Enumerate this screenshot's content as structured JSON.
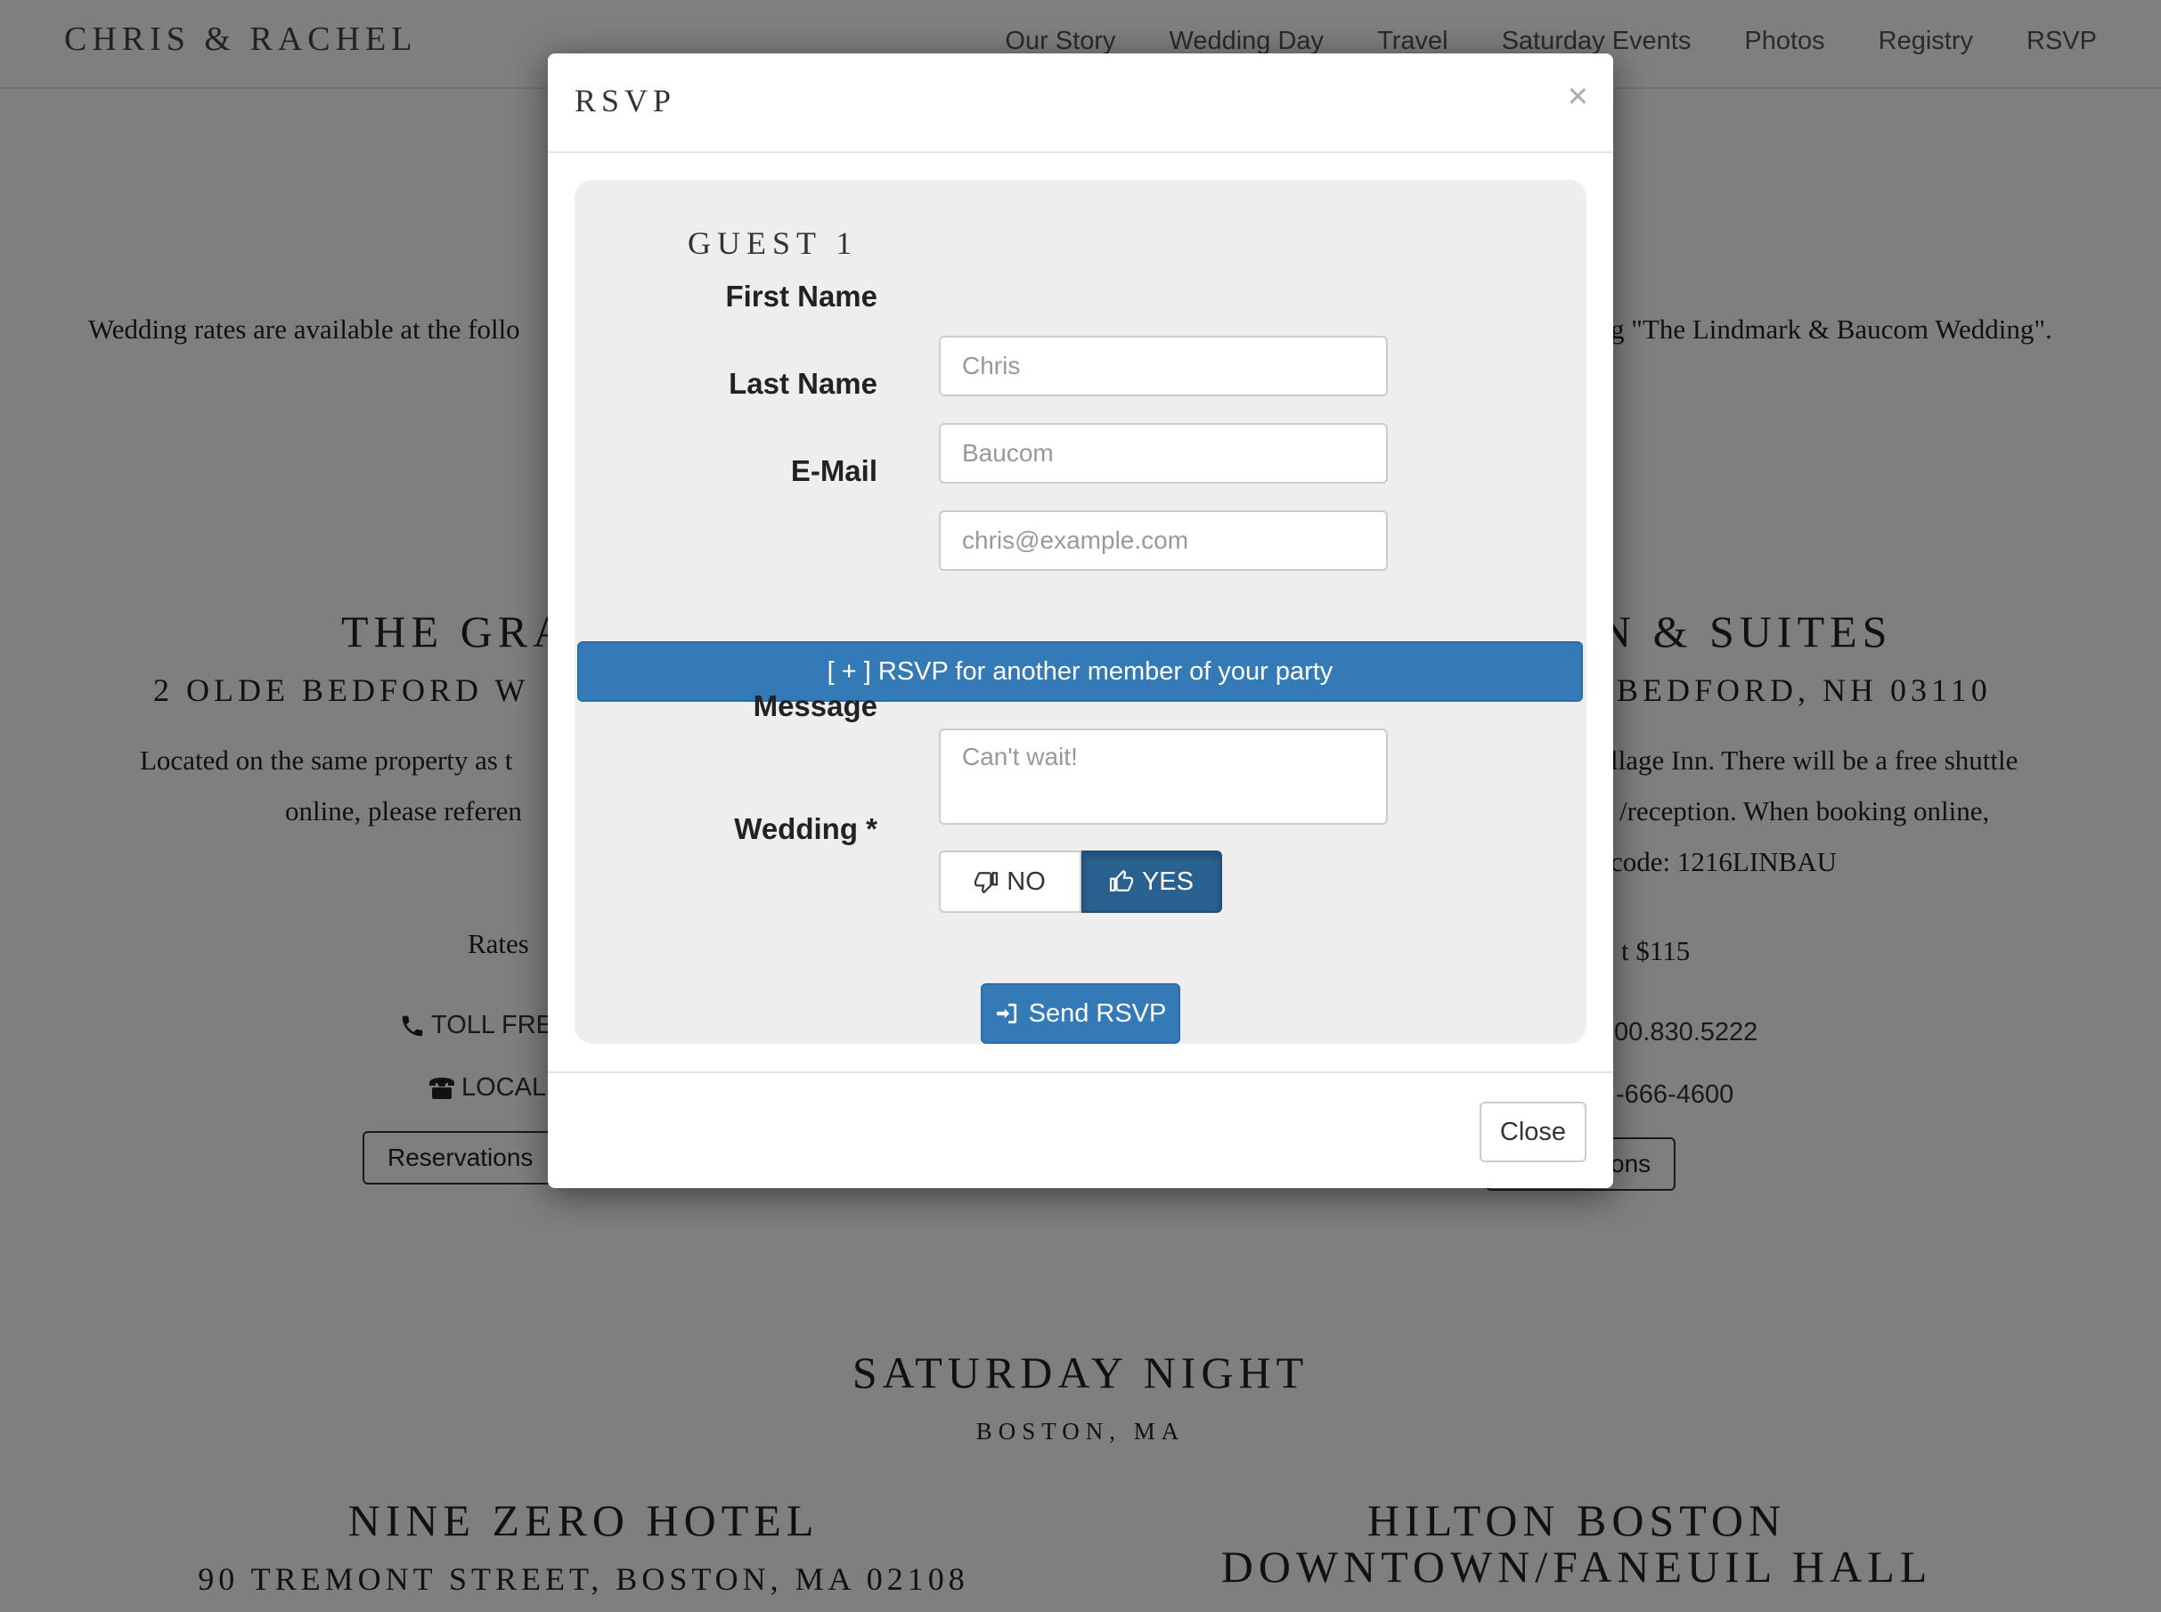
{
  "nav": {
    "brand": "CHRIS & RACHEL",
    "links": [
      "Our Story",
      "Wedding Day",
      "Travel",
      "Saturday Events",
      "Photos",
      "Registry",
      "RSVP"
    ]
  },
  "background": {
    "intro_left": "Wedding rates are available at the follo",
    "intro_right": "g \"The Lindmark & Baucom Wedding\".",
    "hotel_left": {
      "title": "THE GRA",
      "address": "2 OLDE BEDFORD W",
      "para_line1": "Located on the same property as t",
      "para_line2": "online, please referen",
      "rates": "Rates",
      "toll_free": "TOLL FRE",
      "local": "LOCAL",
      "button": "Reservations"
    },
    "hotel_right": {
      "title": "N & SUITES",
      "address": ", BEDFORD, NH 03110",
      "para_line1": "llage Inn. There will be a free shuttle",
      "para_line2": "/reception. When booking online,",
      "para_line3": "code: 1216LINBAU",
      "rates": "t $115",
      "toll_free": "00.830.5222",
      "local": "-666-4600",
      "button": "ons"
    },
    "saturday": {
      "title": "SATURDAY NIGHT",
      "subtitle": "BOSTON, MA"
    },
    "hotel3": {
      "title": "NINE ZERO HOTEL",
      "address": "90 TREMONT STREET, BOSTON, MA 02108"
    },
    "hotel4": {
      "title_line1": "HILTON BOSTON",
      "title_line2": "DOWNTOWN/FANEUIL HALL"
    }
  },
  "modal": {
    "title": "RSVP",
    "close_symbol": "×",
    "guest_heading": "GUEST 1",
    "first_name_label": "First Name",
    "first_name_placeholder": "Chris",
    "last_name_label": "Last Name",
    "last_name_placeholder": "Baucom",
    "email_label": "E-Mail",
    "email_placeholder": "chris@example.com",
    "add_party_label": "[ + ] RSVP for another member of your party",
    "message_label": "Message",
    "message_placeholder": "Can't wait!",
    "wedding_label": "Wedding *",
    "no_label": "NO",
    "yes_label": "YES",
    "selected": "YES",
    "send_label": "Send RSVP",
    "footer_close_label": "Close"
  },
  "colors": {
    "primary": "#337ab7",
    "active": "#286090",
    "backdrop": "rgba(0,0,0,0.5)"
  },
  "icons": {
    "no": "thumbs-down-icon",
    "yes": "thumbs-up-icon",
    "send": "sign-in-icon",
    "phone": "phone-icon",
    "local": "old-phone-icon"
  }
}
